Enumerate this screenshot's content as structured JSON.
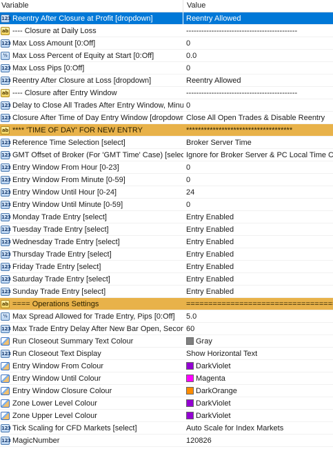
{
  "header": {
    "variable": "Variable",
    "value": "Value"
  },
  "rows": [
    {
      "icon": "int",
      "label": "Reentry After Closure at Profit [dropdown]",
      "value": "Reentry Allowed",
      "state": "selected"
    },
    {
      "icon": "ab",
      "label": "---- Closure at Daily Loss",
      "value": "--------------------------------------------"
    },
    {
      "icon": "int",
      "label": "Max Loss Amount [0:Off]",
      "value": "0"
    },
    {
      "icon": "frac",
      "label": "Max Loss Percent of Equity at Start [0:Off]",
      "value": "0.0"
    },
    {
      "icon": "int",
      "label": "Max Loss Pips [0:Off]",
      "value": "0"
    },
    {
      "icon": "int",
      "label": "Reentry After Closure at Loss [dropdown]",
      "value": "Reentry Allowed"
    },
    {
      "icon": "ab",
      "label": "---- Closure after Entry Window",
      "value": "--------------------------------------------"
    },
    {
      "icon": "int",
      "label": "Delay to Close All Trades After Entry Window, Minute [...",
      "value": "0"
    },
    {
      "icon": "int",
      "label": "Closure After Time of Day Entry Window [dropdown]",
      "value": "Close All Open Trades & Disable Reentry"
    },
    {
      "icon": "ab",
      "label": "**** 'TIME OF DAY' FOR NEW ENTRY",
      "value": "************************************",
      "state": "group"
    },
    {
      "icon": "int",
      "label": "Reference Time Selection [select]",
      "value": "Broker Server Time"
    },
    {
      "icon": "int",
      "label": "GMT Offset of Broker (For 'GMT Time' Case) [select]",
      "value": "Ignore for Broker Server & PC Local Time Cases"
    },
    {
      "icon": "int",
      "label": "Entry Window From Hour [0-23]",
      "value": "0"
    },
    {
      "icon": "int",
      "label": "Entry Window From Minute [0-59]",
      "value": "0"
    },
    {
      "icon": "int",
      "label": "Entry Window Until Hour [0-24]",
      "value": "24"
    },
    {
      "icon": "int",
      "label": "Entry Window Until Minute [0-59]",
      "value": "0"
    },
    {
      "icon": "int",
      "label": "Monday Trade Entry [select]",
      "value": "Entry Enabled"
    },
    {
      "icon": "int",
      "label": "Tuesday Trade Entry [select]",
      "value": "Entry Enabled"
    },
    {
      "icon": "int",
      "label": "Wednesday Trade Entry [select]",
      "value": "Entry Enabled"
    },
    {
      "icon": "int",
      "label": "Thursday Trade Entry [select]",
      "value": "Entry Enabled"
    },
    {
      "icon": "int",
      "label": "Friday Trade Entry [select]",
      "value": "Entry Enabled"
    },
    {
      "icon": "int",
      "label": "Saturday Trade Entry [select]",
      "value": "Entry Enabled"
    },
    {
      "icon": "int",
      "label": "Sunday Trade Entry [select]",
      "value": "Entry Enabled"
    },
    {
      "icon": "ab",
      "label": "==== Operations Settings",
      "value": "======================================",
      "state": "group"
    },
    {
      "icon": "frac",
      "label": "Max Spread Allowed for Trade Entry, Pips [0:Off]",
      "value": "5.0"
    },
    {
      "icon": "int",
      "label": "Max Trade Entry Delay After New Bar Open, Seconds [...",
      "value": "60"
    },
    {
      "icon": "color",
      "label": "Run Closeout Summary Text Colour",
      "value": "Gray",
      "swatch": "#808080"
    },
    {
      "icon": "int",
      "label": "Run Closeout Text Display",
      "value": "Show Horizontal Text"
    },
    {
      "icon": "color",
      "label": "Entry Window From Colour",
      "value": "DarkViolet",
      "swatch": "#9400d3"
    },
    {
      "icon": "color",
      "label": "Entry Window Until Colour",
      "value": "Magenta",
      "swatch": "#ff00ff"
    },
    {
      "icon": "color",
      "label": "Entry Window Closure Colour",
      "value": "DarkOrange",
      "swatch": "#ff8c00"
    },
    {
      "icon": "color",
      "label": "Zone Lower Level Colour",
      "value": "DarkViolet",
      "swatch": "#9400d3"
    },
    {
      "icon": "color",
      "label": "Zone Upper Level Colour",
      "value": "DarkViolet",
      "swatch": "#9400d3"
    },
    {
      "icon": "int",
      "label": "Tick Scaling for CFD Markets [select]",
      "value": "Auto Scale for Index Markets"
    },
    {
      "icon": "int",
      "label": "MagicNumber",
      "value": "120826"
    }
  ],
  "icon_glyphs": {
    "int": "123",
    "frac": "½",
    "ab": "ab"
  }
}
